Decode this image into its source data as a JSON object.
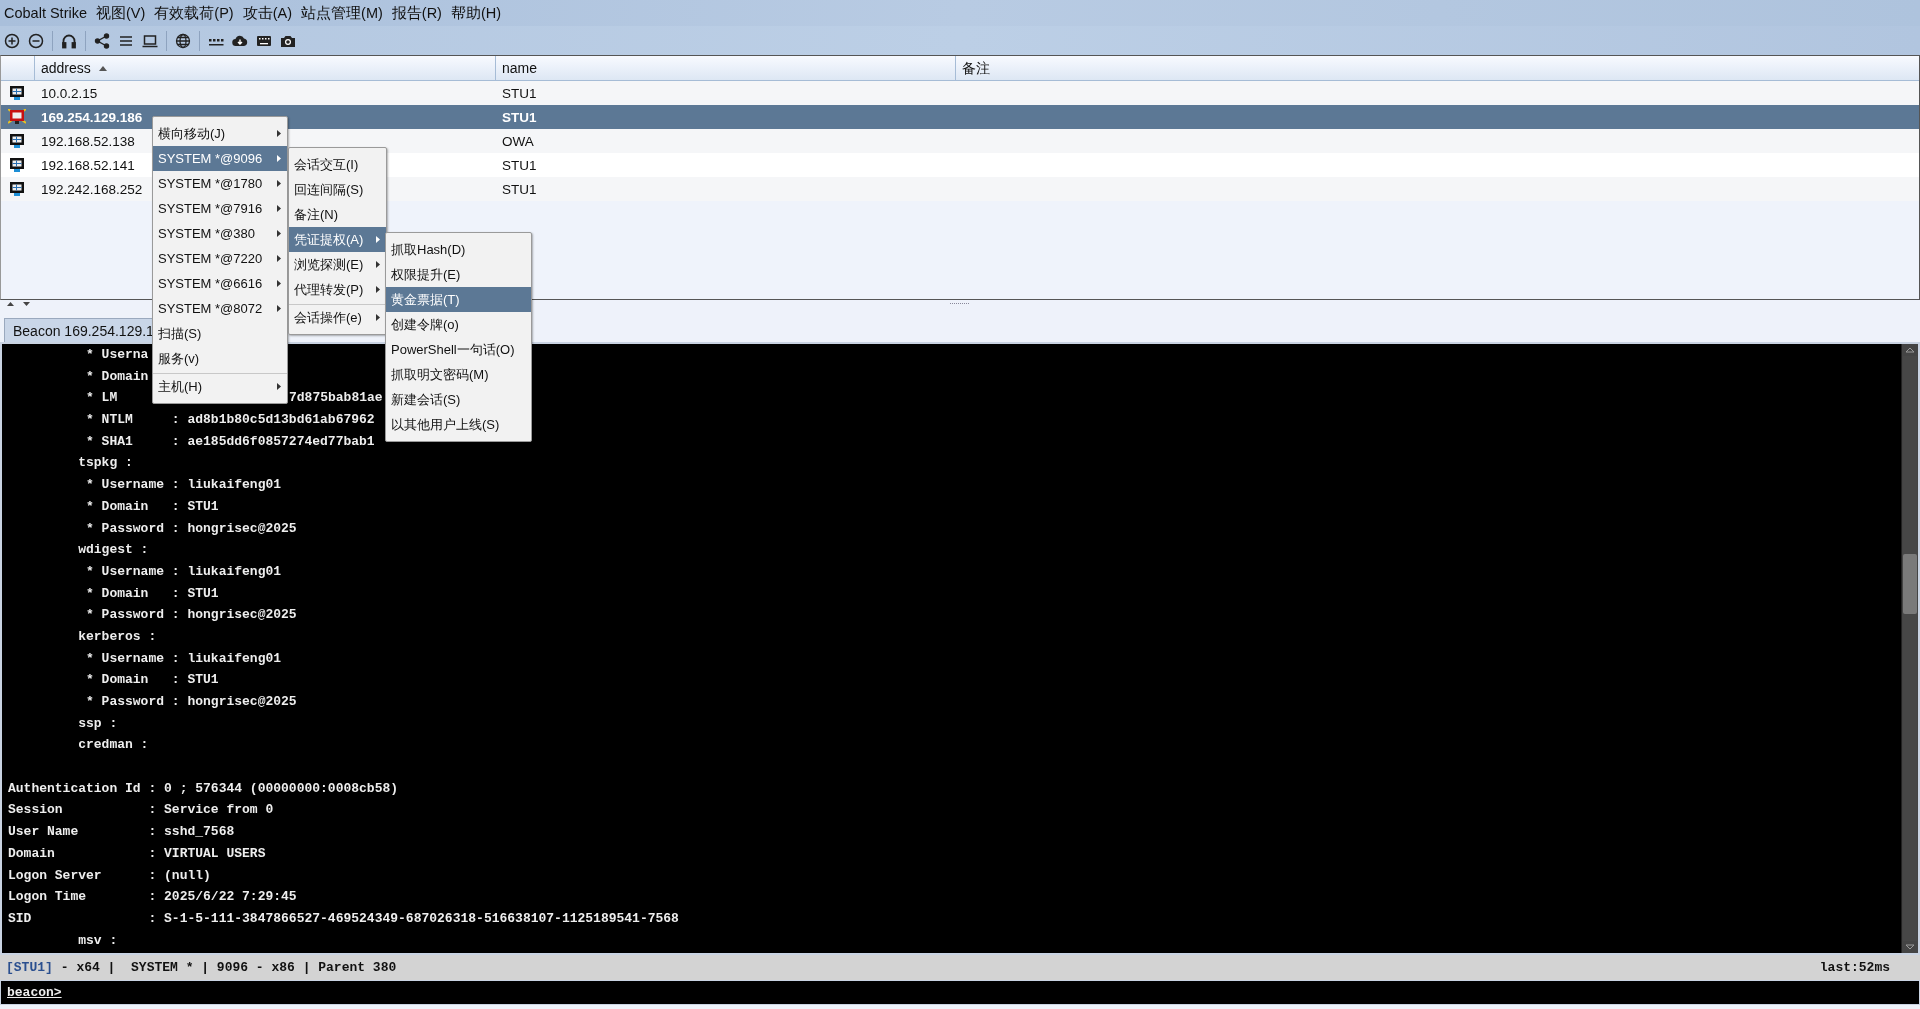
{
  "menubar": [
    "Cobalt Strike",
    "视图(V)",
    "有效载荷(P)",
    "攻击(A)",
    "站点管理(M)",
    "报告(R)",
    "帮助(H)"
  ],
  "table": {
    "columns": [
      {
        "label": "address",
        "sorted": true
      },
      {
        "label": "name",
        "sorted": false
      },
      {
        "label": "备注",
        "sorted": false
      }
    ],
    "rows": [
      {
        "address": "10.0.2.15",
        "name": "STU1",
        "selected": false,
        "admin": false
      },
      {
        "address": "169.254.129.186",
        "name": "STU1",
        "selected": true,
        "admin": true
      },
      {
        "address": "192.168.52.138",
        "name": "OWA",
        "selected": false,
        "admin": false
      },
      {
        "address": "192.168.52.141",
        "name": "STU1",
        "selected": false,
        "admin": false
      },
      {
        "address": "192.242.168.252",
        "name": "STU1",
        "selected": false,
        "admin": false
      }
    ]
  },
  "tabs": [
    {
      "label": "Beacon 169.254.129.1",
      "selected": true
    }
  ],
  "console": {
    "lines": [
      {
        "kind": "text",
        "text": "          * Userna"
      },
      {
        "kind": "text",
        "text": "          * Domain"
      },
      {
        "kind": "text",
        "text": "          * LM",
        "tail": "7d875bab81ae"
      },
      {
        "kind": "text",
        "text": "          * NTLM     : ad8b1b80c5d13bd61ab67962"
      },
      {
        "kind": "text",
        "text": "          * SHA1     : ae185dd6f0857274ed77bab1"
      },
      {
        "kind": "text",
        "text": "         tspkg :"
      },
      {
        "kind": "text",
        "text": "          * Username : liukaifeng01"
      },
      {
        "kind": "text",
        "text": "          * Domain   : STU1"
      },
      {
        "kind": "text",
        "text": "          * Password : hongrisec@2025"
      },
      {
        "kind": "text",
        "text": "         wdigest :"
      },
      {
        "kind": "text",
        "text": "          * Username : liukaifeng01"
      },
      {
        "kind": "text",
        "text": "          * Domain   : STU1"
      },
      {
        "kind": "text",
        "text": "          * Password : hongrisec@2025"
      },
      {
        "kind": "text",
        "text": "         kerberos :"
      },
      {
        "kind": "text",
        "text": "          * Username : liukaifeng01"
      },
      {
        "kind": "text",
        "text": "          * Domain   : STU1"
      },
      {
        "kind": "text",
        "text": "          * Password : hongrisec@2025"
      },
      {
        "kind": "text",
        "text": "         ssp :"
      },
      {
        "kind": "text",
        "text": "         credman :"
      },
      {
        "kind": "blank"
      },
      {
        "kind": "text",
        "text": "Authentication Id : 0 ; 576344 (00000000:0008cb58)"
      },
      {
        "kind": "text",
        "text": "Session           : Service from 0"
      },
      {
        "kind": "text",
        "text": "User Name         : sshd_7568"
      },
      {
        "kind": "text",
        "text": "Domain            : VIRTUAL USERS"
      },
      {
        "kind": "text",
        "text": "Logon Server      : (null)"
      },
      {
        "kind": "text",
        "text": "Logon Time        : 2025/6/22 7:29:45"
      },
      {
        "kind": "text",
        "text": "SID               : S-1-5-111-3847866527-469524349-687026318-516638107-1125189541-7568"
      },
      {
        "kind": "text",
        "text": "         msv :"
      }
    ]
  },
  "status": {
    "host": "[STU1]",
    "info": "- x64 |  SYSTEM * | 9096 - x86 | Parent 380",
    "latency": "last:52ms"
  },
  "prompt": "beacon>",
  "menus": [
    {
      "items": [
        {
          "label": "横向移动(J)",
          "submenu": true,
          "selected": false,
          "separator": false
        },
        {
          "label": "SYSTEM *@9096",
          "submenu": true,
          "selected": true,
          "separator": false
        },
        {
          "label": "SYSTEM *@1780",
          "submenu": true,
          "selected": false,
          "separator": false
        },
        {
          "label": "SYSTEM *@7916",
          "submenu": true,
          "selected": false,
          "separator": false
        },
        {
          "label": "SYSTEM *@380",
          "submenu": true,
          "selected": false,
          "separator": false
        },
        {
          "label": "SYSTEM *@7220",
          "submenu": true,
          "selected": false,
          "separator": false
        },
        {
          "label": "SYSTEM *@6616",
          "submenu": true,
          "selected": false,
          "separator": false
        },
        {
          "label": "SYSTEM *@8072",
          "submenu": true,
          "selected": false,
          "separator": false
        },
        {
          "label": "扫描(S)",
          "submenu": false,
          "selected": false,
          "separator": false
        },
        {
          "label": "服务(v)",
          "submenu": false,
          "selected": false,
          "separator": false
        },
        {
          "label": "主机(H)",
          "submenu": true,
          "selected": false,
          "separator": true
        }
      ]
    },
    {
      "items": [
        {
          "label": "会话交互(I)",
          "submenu": false,
          "selected": false,
          "separator": false
        },
        {
          "label": "回连间隔(S)",
          "submenu": false,
          "selected": false,
          "separator": false
        },
        {
          "label": "备注(N)",
          "submenu": false,
          "selected": false,
          "separator": false
        },
        {
          "label": "凭证提权(A)",
          "submenu": true,
          "selected": true,
          "separator": false
        },
        {
          "label": "浏览探测(E)",
          "submenu": true,
          "selected": false,
          "separator": false
        },
        {
          "label": "代理转发(P)",
          "submenu": true,
          "selected": false,
          "separator": false
        },
        {
          "label": "会话操作(e)",
          "submenu": true,
          "selected": false,
          "separator": true
        }
      ]
    },
    {
      "items": [
        {
          "label": "抓取Hash(D)",
          "submenu": false,
          "selected": false,
          "separator": false
        },
        {
          "label": "权限提升(E)",
          "submenu": false,
          "selected": false,
          "separator": false
        },
        {
          "label": "黄金票据(T)",
          "submenu": false,
          "selected": true,
          "separator": false
        },
        {
          "label": "创建令牌(o)",
          "submenu": false,
          "selected": false,
          "separator": false
        },
        {
          "label": "PowerShell一句话(O)",
          "submenu": false,
          "selected": false,
          "separator": false
        },
        {
          "label": "抓取明文密码(M)",
          "submenu": false,
          "selected": false,
          "separator": false
        },
        {
          "label": "新建会话(S)",
          "submenu": false,
          "selected": false,
          "separator": false
        },
        {
          "label": "以其他用户上线(S)",
          "submenu": false,
          "selected": false,
          "separator": false
        }
      ]
    }
  ]
}
